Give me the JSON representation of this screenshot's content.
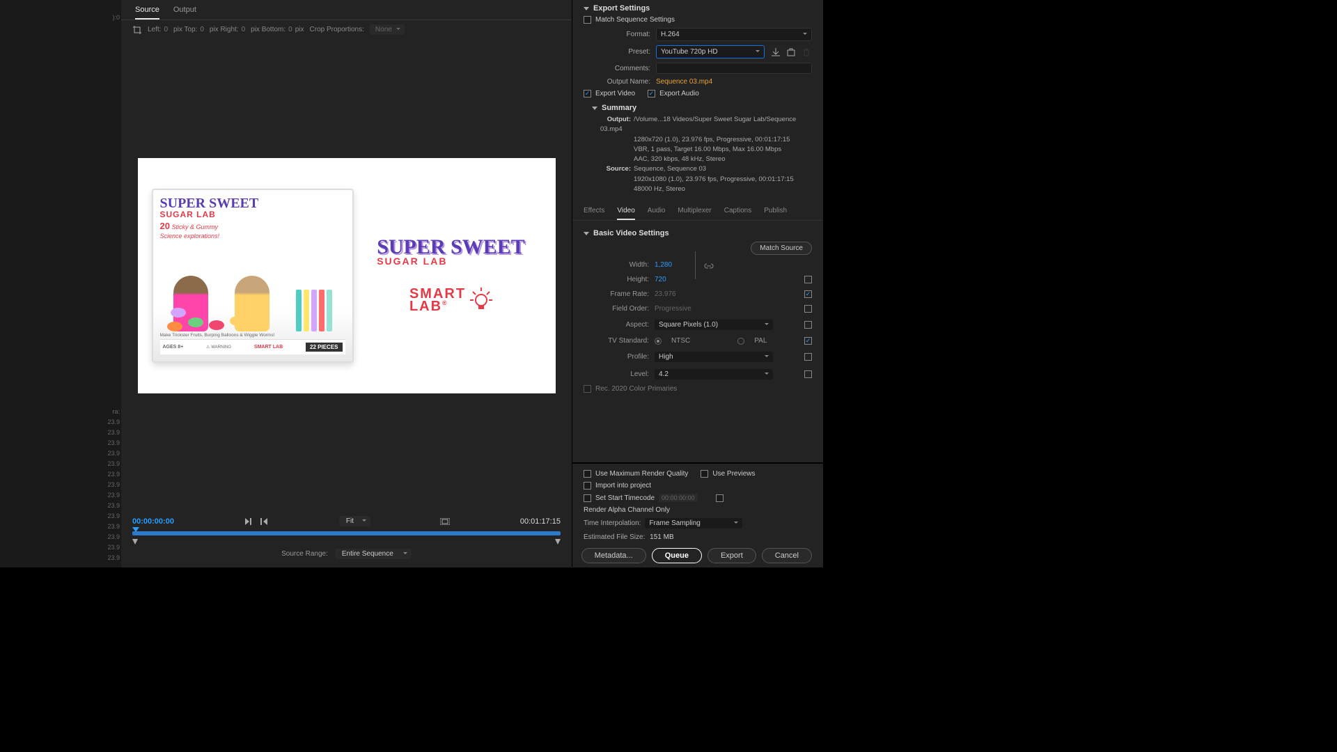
{
  "leftStrip": {
    "marker": "):0",
    "labels": [
      "ra:",
      "23.9",
      "23.9",
      "23.9",
      "23.9",
      "23.9",
      "23.9",
      "23.9",
      "23.9",
      "23.9",
      "23.9",
      "23.9",
      "23.9",
      "23.9",
      "23.9",
      "23.9"
    ]
  },
  "tabs": {
    "source": "Source",
    "output": "Output"
  },
  "crop": {
    "leftLbl": "Left:",
    "leftVal": "0",
    "pxTop": "pix  Top:",
    "topVal": "0",
    "pxRight": "pix  Right:",
    "rightVal": "0",
    "pxBottom": "pix  Bottom:",
    "bottomVal": "0",
    "pxSuffix": "pix",
    "propLbl": "Crop Proportions:",
    "propVal": "None"
  },
  "preview": {
    "boxTitle1": "SUPER SWEET",
    "boxSub": "SUGAR LAB",
    "boxTag1": "20",
    "boxTag2": "Sticky & Gummy",
    "boxTag3": "Science explorations!",
    "boxNote": "Make Trickster Fruits, Burping Balloons & Wiggle Worms!",
    "warn": "WARNING",
    "ages": "AGES 8+",
    "pieces": "22 PIECES",
    "logoTitle": "SUPER SWEET",
    "logoSub": "SUGAR LAB",
    "brandLine1": "SMART",
    "brandLine2": "LAB"
  },
  "timeline": {
    "current": "00:00:00:00",
    "fit": "Fit",
    "duration": "00:01:17:15",
    "srcRangeLbl": "Source Range:",
    "srcRangeVal": "Entire Sequence"
  },
  "export": {
    "settingsHdr": "Export Settings",
    "matchSeq": "Match Sequence Settings",
    "fmtLbl": "Format:",
    "fmtVal": "H.264",
    "presetLbl": "Preset:",
    "presetVal": "YouTube 720p HD",
    "commentsLbl": "Comments:",
    "commentsVal": "",
    "outNameLbl": "Output Name:",
    "outNameVal": "Sequence 03.mp4",
    "expVideo": "Export Video",
    "expAudio": "Export Audio",
    "summaryHdr": "Summary",
    "sumOutputLbl": "Output:",
    "sumOutput1": "/Volume...18 Videos/Super Sweet Sugar Lab/Sequence 03.mp4",
    "sumOutput2": "1280x720 (1.0), 23.976 fps, Progressive, 00:01:17:15",
    "sumOutput3": "VBR, 1 pass, Target 16.00 Mbps, Max 16.00 Mbps",
    "sumOutput4": "AAC, 320 kbps, 48 kHz, Stereo",
    "sumSourceLbl": "Source:",
    "sumSource1": "Sequence, Sequence 03",
    "sumSource2": "1920x1080 (1.0), 23.976 fps, Progressive, 00:01:17:15",
    "sumSource3": "48000 Hz, Stereo"
  },
  "subTabs": {
    "effects": "Effects",
    "video": "Video",
    "audio": "Audio",
    "multiplexer": "Multiplexer",
    "captions": "Captions",
    "publish": "Publish"
  },
  "videoSettings": {
    "hdr": "Basic Video Settings",
    "matchSrc": "Match Source",
    "widthLbl": "Width:",
    "widthVal": "1,280",
    "heightLbl": "Height:",
    "heightVal": "720",
    "fpsLbl": "Frame Rate:",
    "fpsVal": "23.976",
    "fieldLbl": "Field Order:",
    "fieldVal": "Progressive",
    "aspectLbl": "Aspect:",
    "aspectVal": "Square Pixels (1.0)",
    "tvLbl": "TV Standard:",
    "tvNtsc": "NTSC",
    "tvPal": "PAL",
    "profileLbl": "Profile:",
    "profileVal": "High",
    "levelLbl": "Level:",
    "levelVal": "4.2",
    "rec2020": "Rec. 2020 Color Primaries"
  },
  "bottom": {
    "maxQual": "Use Maximum Render Quality",
    "previews": "Use Previews",
    "importProj": "Import into project",
    "setStart": "Set Start Timecode",
    "startVal": "00:00:00:00",
    "alphaOnly": "Render Alpha Channel Only",
    "tiLbl": "Time Interpolation:",
    "tiVal": "Frame Sampling",
    "estLbl": "Estimated File Size:",
    "estVal": "151 MB",
    "meta": "Metadata...",
    "queue": "Queue",
    "export": "Export",
    "cancel": "Cancel"
  }
}
